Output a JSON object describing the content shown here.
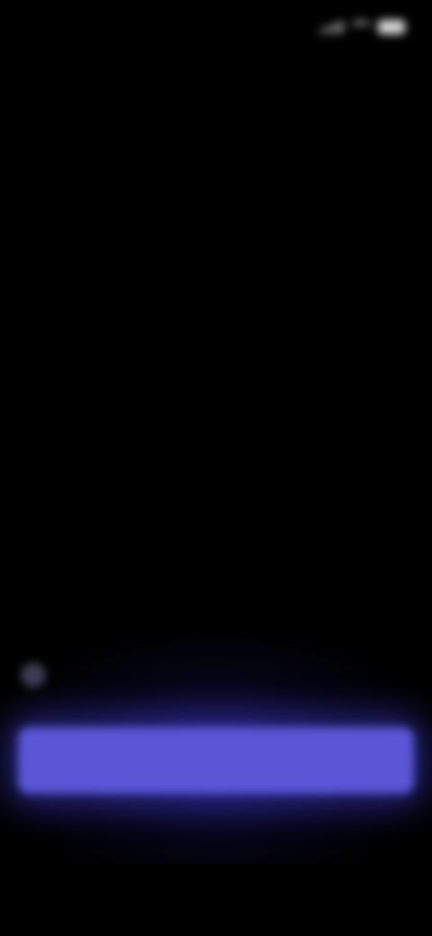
{
  "status_bar": {
    "time": "",
    "signal_icon": "signal-icon",
    "wifi_icon": "wifi-icon",
    "battery_icon": "battery-icon"
  },
  "header": {
    "skip_label": ""
  },
  "main": {
    "title": "",
    "subtitle": "",
    "code_label": ""
  },
  "consent": {
    "checkbox_icon": "checkbox-icon",
    "text": ""
  },
  "actions": {
    "primary_label": ""
  },
  "footer": {
    "text": ""
  },
  "colors": {
    "background": "#000000",
    "accent": "#5a56d6"
  }
}
